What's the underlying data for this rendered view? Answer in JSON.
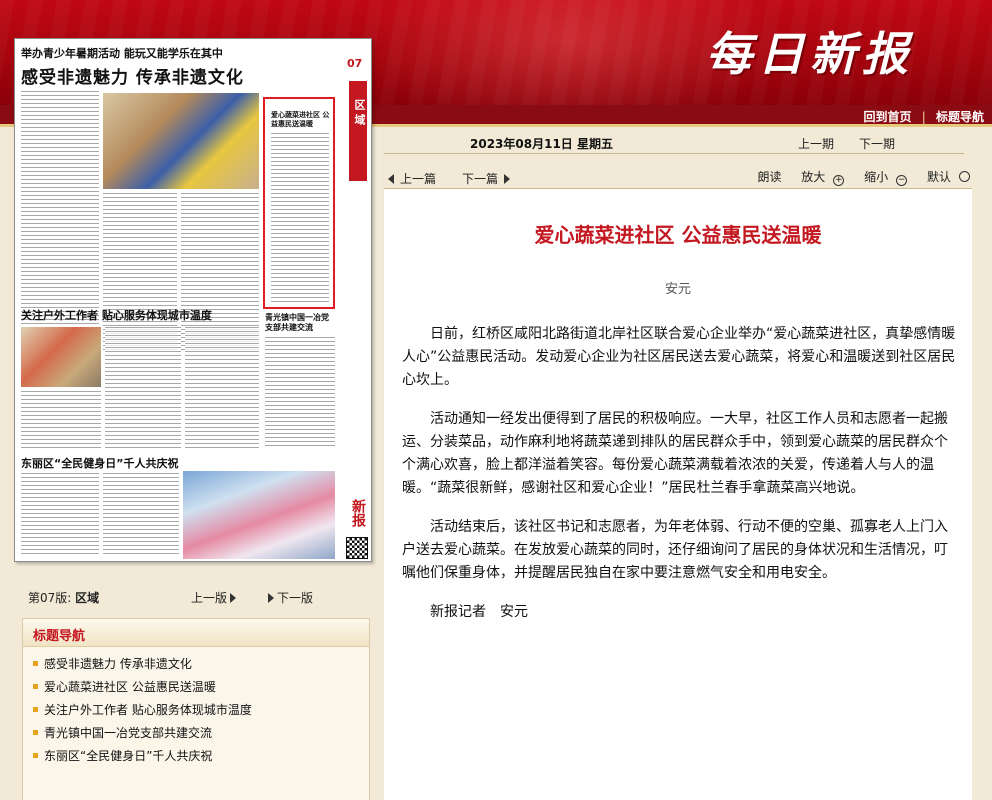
{
  "header": {
    "logo": "每日新报",
    "links": [
      "回到首页",
      "标题导航"
    ],
    "separator": "|"
  },
  "toolbar": {
    "date": "2023年08月11日 星期五",
    "prev": "上一期",
    "next": "下一期"
  },
  "article_tools": {
    "prev": "上一篇",
    "next": "下一篇",
    "read": "朗读",
    "zoom_in": "放大",
    "zoom_out": "缩小",
    "default": "默认",
    "plus": "+",
    "minus": "−"
  },
  "newspaper": {
    "kicker": "举办青少年暑期活动 能玩又能学乐在其中",
    "title": "感受非遗魅力 传承非遗文化",
    "page_num": "07",
    "section": "区域",
    "highlight_title": "爱心蔬菜进社区 公益惠民送温暖",
    "sub1": "关注户外工作者 贴心服务体现城市温度",
    "sub2": "东丽区“全民健身日”千人共庆祝",
    "sub3": "青光镇中国一冶党支部共建交流",
    "mark": "新报"
  },
  "page_nav": {
    "version_label": "第07版:",
    "version_name": "区域",
    "prev": "上一版",
    "next": "下一版"
  },
  "title_nav": {
    "title": "标题导航",
    "items": [
      "感受非遗魅力 传承非遗文化",
      "爱心蔬菜进社区 公益惠民送温暖",
      "关注户外工作者 贴心服务体现城市温度",
      "青光镇中国一冶党支部共建交流",
      "东丽区“全民健身日”千人共庆祝"
    ]
  },
  "article": {
    "title": "爱心蔬菜进社区 公益惠民送温暖",
    "author": "安元",
    "paragraphs": [
      "日前，红桥区咸阳北路街道北岸社区联合爱心企业举办“爱心蔬菜进社区，真挚感情暖人心”公益惠民活动。发动爱心企业为社区居民送去爱心蔬菜，将爱心和温暖送到社区居民心坎上。",
      "活动通知一经发出便得到了居民的积极响应。一大早，社区工作人员和志愿者一起搬运、分装菜品，动作麻利地将蔬菜递到排队的居民群众手中，领到爱心蔬菜的居民群众个个满心欢喜，脸上都洋溢着笑容。每份爱心蔬菜满载着浓浓的关爱，传递着人与人的温暖。“蔬菜很新鲜，感谢社区和爱心企业！”居民杜兰春手拿蔬菜高兴地说。",
      "活动结束后，该社区书记和志愿者，为年老体弱、行动不便的空巢、孤寡老人上门入户送去爱心蔬菜。在发放爱心蔬菜的同时，还仔细询问了居民的身体状况和生活情况，叮嘱他们保重身体，并提醒居民独自在家中要注意燃气安全和用电安全。",
      "新报记者　安元"
    ]
  },
  "colors": {
    "header_red": "#b0050f",
    "title_red": "#c41820",
    "background": "#f2ead6",
    "bullet": "#e8a11a",
    "highlight_border": "#e01b22"
  }
}
